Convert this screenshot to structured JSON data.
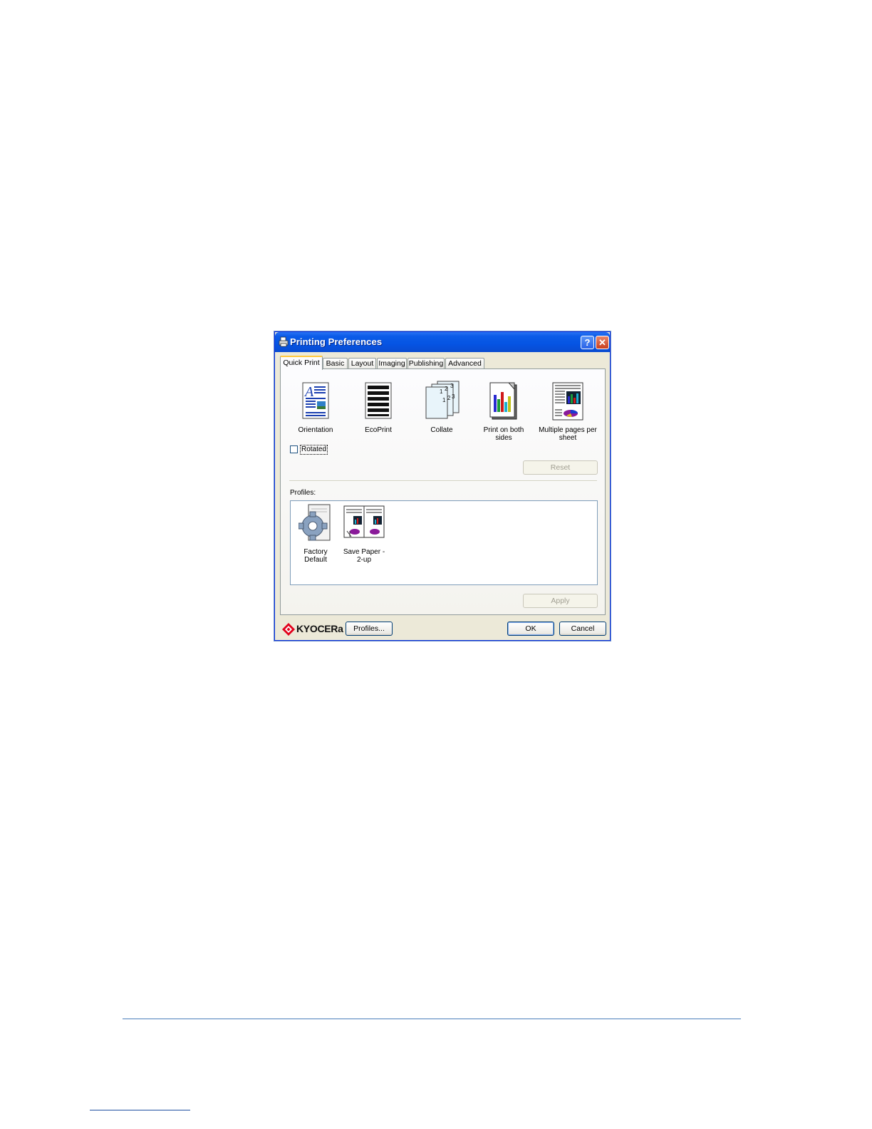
{
  "window": {
    "title": "Printing Preferences",
    "help_label": "?",
    "close_label": "✕"
  },
  "tabs": [
    {
      "label": "Quick Print",
      "active": true
    },
    {
      "label": "Basic"
    },
    {
      "label": "Layout"
    },
    {
      "label": "Imaging"
    },
    {
      "label": "Publishing"
    },
    {
      "label": "Advanced"
    }
  ],
  "features": [
    {
      "label": "Orientation",
      "icon": "orientation-icon"
    },
    {
      "label": "EcoPrint",
      "icon": "ecoprint-icon"
    },
    {
      "label": "Collate",
      "icon": "collate-icon"
    },
    {
      "label": "Print on both sides",
      "icon": "duplex-icon"
    },
    {
      "label": "Multiple pages per sheet",
      "icon": "multiple-pages-icon"
    }
  ],
  "rotated": {
    "label": "Rotated",
    "checked": false
  },
  "reset_label": "Reset",
  "profiles": {
    "heading": "Profiles:",
    "items": [
      {
        "label": "Factory Default",
        "icon": "factory-default-gear-icon"
      },
      {
        "label": "Save Paper - 2-up",
        "icon": "save-paper-icon"
      }
    ]
  },
  "apply_label": "Apply",
  "footer": {
    "brand": "KYOCERa",
    "profiles_button": "Profiles...",
    "ok": "OK",
    "cancel": "Cancel"
  },
  "colors": {
    "titlebar": "#0554e3",
    "dialog_bg": "#ece9d8",
    "tab_highlight": "#ffc83c",
    "brand_red": "#e2001a"
  }
}
